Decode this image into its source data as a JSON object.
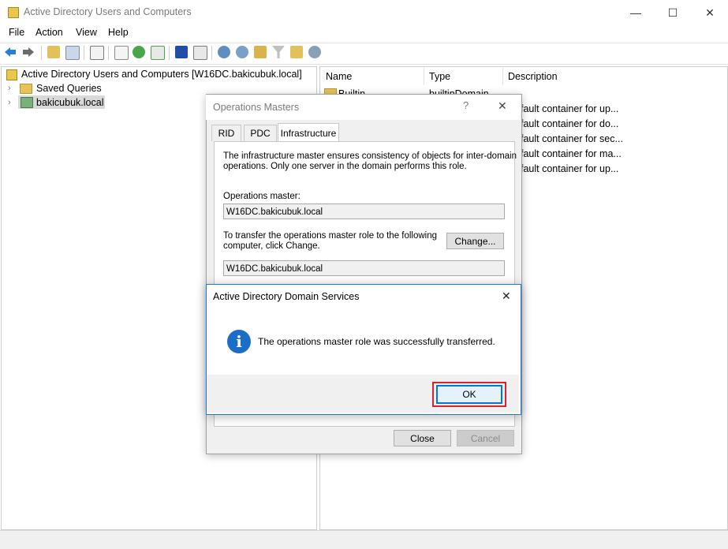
{
  "window": {
    "title": "Active Directory Users and Computers",
    "minimize": "—",
    "maximize": "☐",
    "close": "✕"
  },
  "menu": [
    "File",
    "Action",
    "View",
    "Help"
  ],
  "tree": {
    "root": "Active Directory Users and Computers [W16DC.bakicubuk.local]",
    "items": [
      "Saved Queries",
      "bakicubuk.local"
    ]
  },
  "list": {
    "columns": [
      "Name",
      "Type",
      "Description"
    ],
    "rows": [
      {
        "name": "Builtin",
        "type": "builtinDomain",
        "description": ""
      },
      {
        "name": "",
        "type": "",
        "description": "fault container for up..."
      },
      {
        "name": "",
        "type": "",
        "description": "fault container for do..."
      },
      {
        "name": "",
        "type": "",
        "description": "fault container for sec..."
      },
      {
        "name": "",
        "type": "",
        "description": "fault container for ma..."
      },
      {
        "name": "",
        "type": "",
        "description": "fault container for up..."
      }
    ]
  },
  "ops_dialog": {
    "title": "Operations Masters",
    "help": "?",
    "close": "✕",
    "tabs": [
      "RID",
      "PDC",
      "Infrastructure"
    ],
    "active_tab": "Infrastructure",
    "description_line1": "The infrastructure master ensures consistency of objects for inter-domain",
    "description_line2": "operations. Only one server in the domain performs this role.",
    "master_label": "Operations master:",
    "master_value": "W16DC.bakicubuk.local",
    "transfer_line1": "To transfer the operations master role to the following",
    "transfer_line2": "computer, click Change.",
    "transfer_value": "W16DC.bakicubuk.local",
    "change_button": "Change...",
    "close_button": "Close",
    "cancel_button": "Cancel"
  },
  "msg_dialog": {
    "title": "Active Directory Domain Services",
    "close": "✕",
    "icon": "info-icon",
    "icon_glyph": "i",
    "message": "The operations master role was successfully transferred.",
    "ok_button": "OK"
  },
  "colors": {
    "accent": "#0078d7",
    "info": "#1a6ec7",
    "highlight": "#e0202a"
  }
}
